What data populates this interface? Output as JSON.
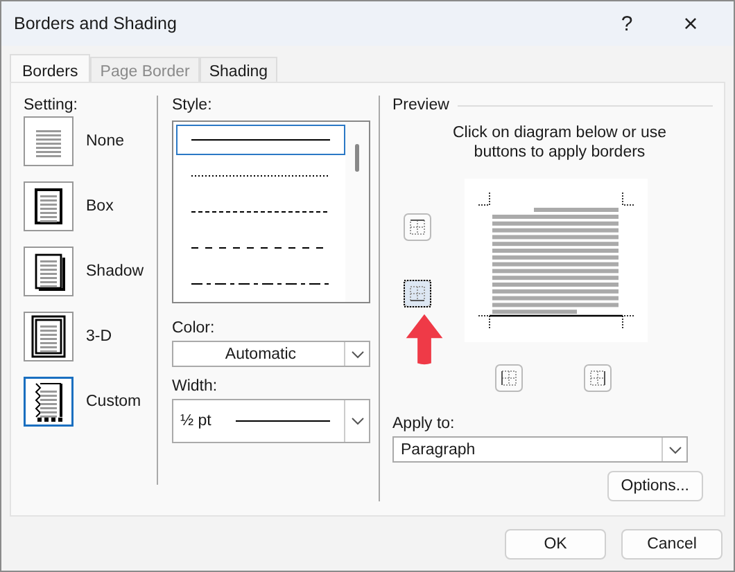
{
  "window": {
    "title": "Borders and Shading",
    "help": "?",
    "close": "×"
  },
  "tabs": [
    {
      "label": "Borders",
      "selected": true,
      "disabled": false
    },
    {
      "label": "Page Border",
      "selected": false,
      "disabled": true
    },
    {
      "label": "Shading",
      "selected": false,
      "disabled": false
    }
  ],
  "setting": {
    "label": "Setting:",
    "items": [
      {
        "label": "None",
        "kind": "none",
        "selected": false
      },
      {
        "label": "Box",
        "kind": "box",
        "selected": false
      },
      {
        "label": "Shadow",
        "kind": "shadow",
        "selected": false
      },
      {
        "label": "3-D",
        "kind": "threed",
        "selected": false
      },
      {
        "label": "Custom",
        "kind": "custom",
        "selected": true
      }
    ]
  },
  "style": {
    "label": "Style:",
    "items": [
      {
        "kind": "solid",
        "selected": true
      },
      {
        "kind": "dotted",
        "selected": false
      },
      {
        "kind": "dashed",
        "selected": false
      },
      {
        "kind": "dash_long",
        "selected": false
      },
      {
        "kind": "dash_dot",
        "selected": false
      }
    ]
  },
  "color": {
    "label": "Color:",
    "value": "Automatic"
  },
  "width": {
    "label": "Width:",
    "value": "½ pt"
  },
  "preview": {
    "label": "Preview",
    "hint": "Click on diagram below or use buttons to apply borders",
    "border_buttons": [
      {
        "kind": "top",
        "on": false,
        "focused": false
      },
      {
        "kind": "bottom",
        "on": true,
        "focused": true
      },
      {
        "kind": "left",
        "on": false,
        "focused": false
      },
      {
        "kind": "right",
        "on": false,
        "focused": false
      }
    ]
  },
  "apply_to": {
    "label": "Apply to:",
    "value": "Paragraph"
  },
  "options_button": "Options...",
  "buttons": [
    "OK",
    "Cancel"
  ]
}
